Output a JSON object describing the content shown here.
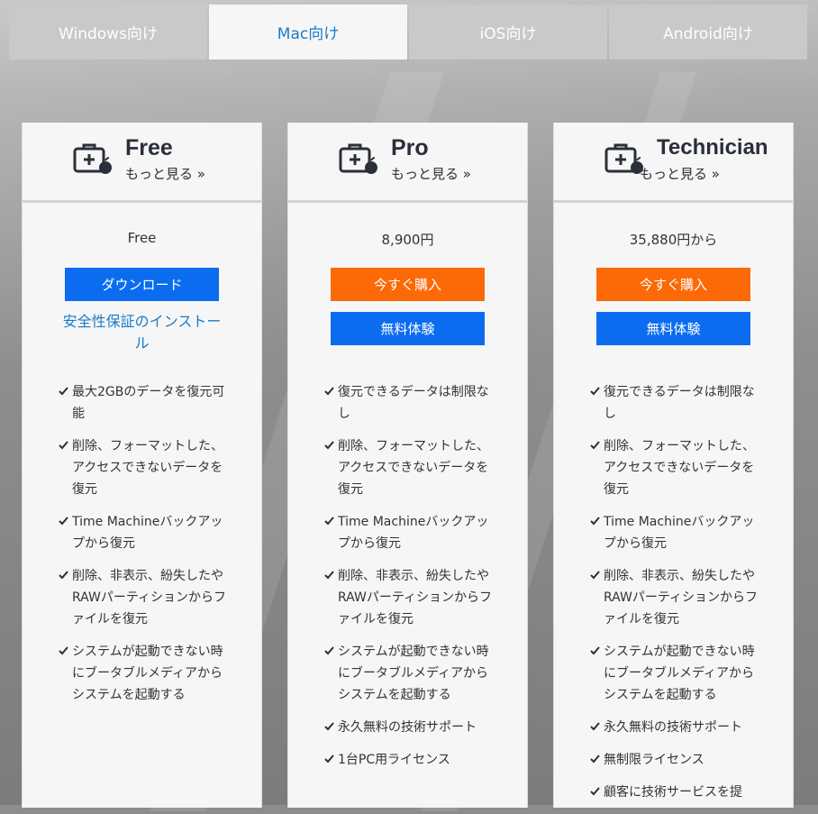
{
  "tabs": [
    {
      "label": "Windows向け",
      "active": false
    },
    {
      "label": "Mac向け",
      "active": true
    },
    {
      "label": "iOS向け",
      "active": false
    },
    {
      "label": "Android向け",
      "active": false
    }
  ],
  "colors": {
    "accent_blue": "#0b6cf0",
    "accent_orange": "#fb6a06",
    "link": "#1a7bc8"
  },
  "plans": [
    {
      "name": "Free",
      "more": "もっと見る »",
      "price": "Free",
      "primary_button": "ダウンロード",
      "install_link": "安全性保証のインストール",
      "features": [
        "最大2GBのデータを復元可能",
        "削除、フォーマットした、アクセスできないデータを復元",
        "Time Machineバックアップから復元",
        "削除、非表示、紛失したやRAWパーティションからファイルを復元",
        "システムが起動できない時にブータブルメディアからシステムを起動する"
      ]
    },
    {
      "name": "Pro",
      "more": "もっと見る »",
      "price": "8,900円",
      "buy_button": "今すぐ購入",
      "trial_button": "無料体験",
      "features": [
        "復元できるデータは制限なし",
        "削除、フォーマットした、アクセスできないデータを復元",
        "Time Machineバックアップから復元",
        "削除、非表示、紛失したやRAWパーティションからファイルを復元",
        "システムが起動できない時にブータブルメディアからシステムを起動する",
        "永久無料の技術サポート",
        "1台PC用ライセンス"
      ]
    },
    {
      "name": "Technician",
      "more": "もっと見る »",
      "price": "35,880円から",
      "buy_button": "今すぐ購入",
      "trial_button": "無料体験",
      "features": [
        "復元できるデータは制限なし",
        "削除、フォーマットした、アクセスできないデータを復元",
        "Time Machineバックアップから復元",
        "削除、非表示、紛失したやRAWパーティションからファイルを復元",
        "システムが起動できない時にブータブルメディアからシステムを起動する",
        "永久無料の技術サポート",
        "無制限ライセンス",
        "顧客に技術サービスを提"
      ]
    }
  ]
}
